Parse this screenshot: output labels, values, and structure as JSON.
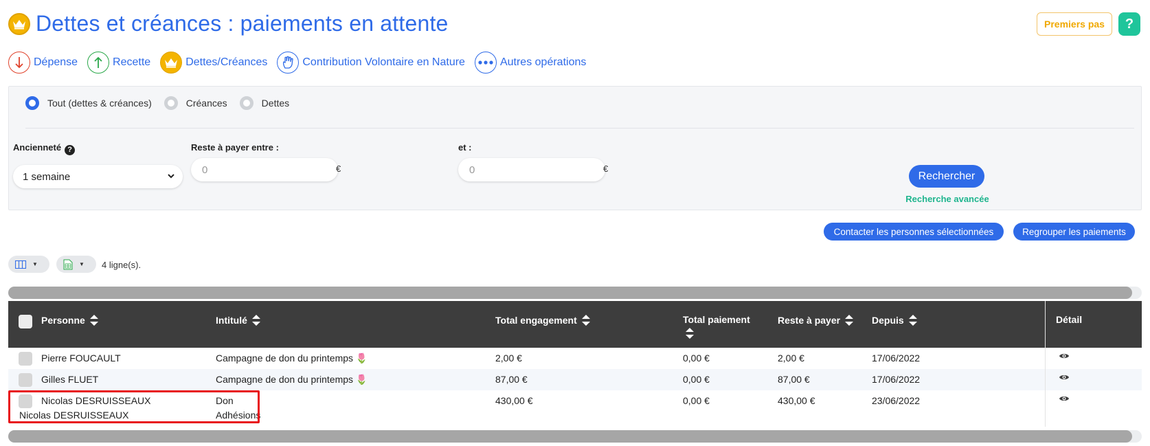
{
  "header": {
    "title": "Dettes et créances : paiements en attente",
    "premiers_pas": "Premiers pas",
    "help": "?"
  },
  "ops_nav": [
    {
      "label": "Dépense",
      "icon": "arrow-down-icon",
      "color": "#e0422b"
    },
    {
      "label": "Recette",
      "icon": "arrow-up-icon",
      "color": "#2aa84a"
    },
    {
      "label": "Dettes/Créances",
      "icon": "crown-icon",
      "color": "#f4b400"
    },
    {
      "label": "Contribution Volontaire en Nature",
      "icon": "hand-icon",
      "color": "#2f6be8"
    },
    {
      "label": "Autres opérations",
      "icon": "more-dots-icon",
      "color": "#2f6be8"
    }
  ],
  "filters": {
    "radios": [
      {
        "label": "Tout (dettes & créances)",
        "selected": true
      },
      {
        "label": "Créances",
        "selected": false
      },
      {
        "label": "Dettes",
        "selected": false
      }
    ],
    "anciennete_label": "Ancienneté",
    "anciennete_value": "1 semaine",
    "reste_label": "Reste à payer entre :",
    "reste_min_placeholder": "0",
    "et_label": "et :",
    "reste_max_placeholder": "0",
    "currency": "€",
    "search_button": "Rechercher",
    "advanced_link": "Recherche avancée"
  },
  "actions": {
    "contact": "Contacter les personnes sélectionnées",
    "group": "Regrouper les paiements"
  },
  "toolbar": {
    "row_count": "4 ligne(s)."
  },
  "table": {
    "columns": {
      "personne": "Personne",
      "intitule": "Intitulé",
      "total_engagement": "Total engagement",
      "total_paiement": "Total paiement",
      "reste": "Reste à payer",
      "depuis": "Depuis",
      "detail": "Détail"
    },
    "rows": [
      {
        "personne": "Pierre FOUCAULT",
        "intitule": "Campagne de don du printemps",
        "emoji": "🌷",
        "total_engagement": "2,00 €",
        "total_paiement": "0,00 €",
        "reste": "2,00 €",
        "depuis": "17/06/2022"
      },
      {
        "personne": "Gilles FLUET",
        "intitule": "Campagne de don du printemps",
        "emoji": "🌷",
        "total_engagement": "87,00 €",
        "total_paiement": "0,00 €",
        "reste": "87,00 €",
        "depuis": "17/06/2022"
      },
      {
        "personne": "Nicolas DESRUISSEAUX",
        "personne_2": "Nicolas DESRUISSEAUX",
        "intitule": "Don",
        "intitule_2": "Adhésions",
        "total_engagement": "430,00 €",
        "total_paiement": "0,00 €",
        "reste": "430,00 €",
        "depuis": "23/06/2022"
      }
    ]
  },
  "colors": {
    "accent": "#2f6be8",
    "teal": "#1fc59b",
    "gold": "#f4b400",
    "header_bg": "#3d3d3d",
    "highlight": "#e8141a"
  }
}
